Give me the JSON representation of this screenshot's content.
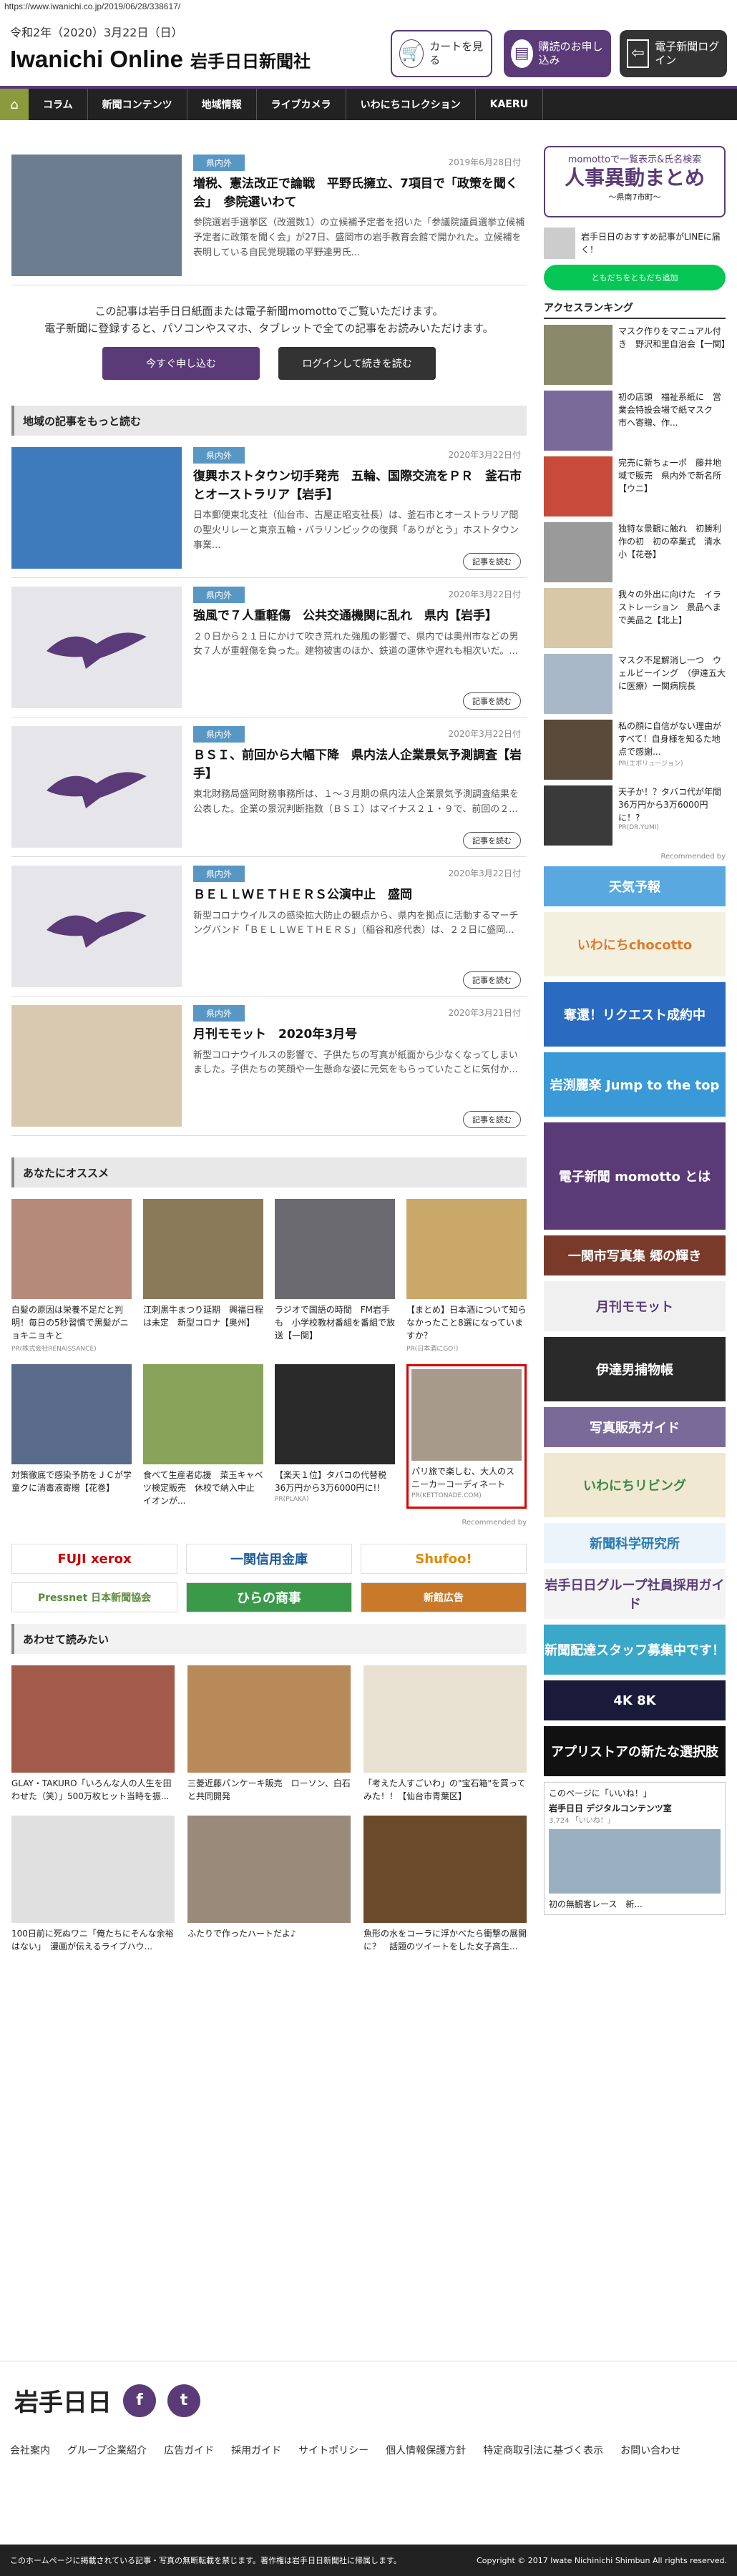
{
  "url": "https://www.iwanichi.co.jp/2019/06/28/338617/",
  "header": {
    "date": "令和2年（2020）3月22日（日）",
    "logo": "Iwanichi Online",
    "logo_sub": "岩手日日新聞社",
    "cart": "カートを見る",
    "subscribe": "購読のお申し込み",
    "login": "電子新聞ログイン"
  },
  "nav": [
    "コラム",
    "新聞コンテンツ",
    "地域情報",
    "ライブカメラ",
    "いわにちコレクション",
    "KAERU"
  ],
  "top_article": {
    "tag": "県内外",
    "date": "2019年6月28日付",
    "title": "増税、憲法改正で論戦　平野氏擁立、7項目で「政策を聞く会」　参院選いわて",
    "text": "参院選岩手選挙区（改選数1）の立候補予定者を招いた「参議院議員選挙立候補予定者に政策を聞く会」が27日、盛岡市の岩手教育会館で開かれた。立候補を表明している自民党現職の平野達男氏..."
  },
  "notice": {
    "line1": "この記事は岩手日日紙面または電子新聞momottoでご覧いただけます。",
    "line2": "電子新聞に登録すると、パソコンやスマホ、タブレットで全ての記事をお読みいただけます。",
    "btn_apply": "今すぐ申し込む",
    "btn_login": "ログインして続きを読む"
  },
  "local_heading": "地域の記事をもっと読む",
  "articles": [
    {
      "tag": "県内外",
      "date": "2020年3月22日付",
      "title": "復興ホストタウン切手発売　五輪、国際交流をＰＲ　釜石市とオーストラリア【岩手】",
      "text": "日本郵便東北支社（仙台市、古屋正昭支社長）は、釜石市とオーストラリア間の聖火リレーと東京五輪・パラリンピックの復興「ありがとう」ホストタウン事業...",
      "more": "記事を読む"
    },
    {
      "tag": "県内外",
      "date": "2020年3月22日付",
      "title": "強風で７人重軽傷　公共交通機関に乱れ　県内【岩手】",
      "text": "２０日から２１日にかけて吹き荒れた強風の影響で、県内では奥州市などの男女７人が重軽傷を負った。建物被害のほか、鉄道の運休や遅れも相次いだ。...",
      "more": "記事を読む"
    },
    {
      "tag": "県内外",
      "date": "2020年3月22日付",
      "title": "ＢＳＩ、前回から大幅下降　県内法人企業景気予測調査【岩手】",
      "text": "東北財務局盛岡財務事務所は、１～３月期の県内法人企業景気予測調査結果を公表した。企業の景況判断指数（ＢＳＩ）はマイナス２１・９で、前回の２...",
      "more": "記事を読む"
    },
    {
      "tag": "県内外",
      "date": "2020年3月22日付",
      "title": "ＢＥＬＬＷＥＴＨＥＲＳ公演中止　盛岡",
      "text": "新型コロナウイルスの感染拡大防止の観点から、県内を拠点に活動するマーチングバンド「ＢＥＬＬＷＥＴＨＥＲＳ」（稲谷和彦代表）は、２２日に盛岡...",
      "more": "記事を読む"
    },
    {
      "tag": "県内外",
      "date": "2020年3月21日付",
      "title": "月刊モモット　2020年3月号",
      "text": "新型コロナウイルスの影響で、子供たちの写真が紙面から少なくなってしまいました。子供たちの笑顔や一生懸命な姿に元気をもらっていたことに気付か...",
      "more": "記事を読む"
    }
  ],
  "recommend_heading": "あなたにオススメ",
  "recommend": [
    {
      "t": "白髪の原因は栄養不足だと判明！毎日の5秒習慣で黒髪がニョキニョキと",
      "s": "PR(株式会社RENAISSANCE)"
    },
    {
      "t": "江刺黒牛まつり延期　興福日程は未定　新型コロナ【奥州】",
      "s": ""
    },
    {
      "t": "ラジオで国語の時間　FM岩手も　小学校教材番組を番組で放送【一関】",
      "s": ""
    },
    {
      "t": "【まとめ】日本酒について知らなかったこと8選になっていますか？",
      "s": "PR(日本酒にGO!)"
    },
    {
      "t": "対策徹底で感染予防をＪＣが学童クに消毒液寄贈【花巻】",
      "s": ""
    },
    {
      "t": "食べて生産者応援　菜玉キャベツ検定販売　休校で納入中止　イオンが...",
      "s": ""
    },
    {
      "t": "【楽天１位】タバコの代替税36万円から3万6000円に!!",
      "s": "PR(PLAKA)"
    },
    {
      "t": "パリ旅で楽しむ、大人のスニーカーコーディネート",
      "s": "PR(KETTONADE.COM)"
    }
  ],
  "recommended_by": "Recommended by",
  "banners": [
    "FUJI xerox",
    "一関信用金庫",
    "Shufoo!",
    "Pressnet 日本新聞協会",
    "ひらの商事",
    "新館広告"
  ],
  "also_heading": "あわせて読みたい",
  "also": [
    {
      "t": "GLAY・TAKURO「いろんな人の人生を田わせた（笑）」500万枚ヒット当時を振..."
    },
    {
      "t": "三菱近藤パンケーキ販売　ローソン、白石と共同開発"
    },
    {
      "t": "「考えた人すごいわ」の\"宝石箱\"を買ってみた！！【仙台市青葉区】"
    },
    {
      "t": "100日前に死ぬワニ「俺たちにそんな余裕はない」　漫画が伝えるライブハウ..."
    },
    {
      "t": "ふたりで作ったハートだよ♪"
    },
    {
      "t": "魚形の水をコーラに浮かべたら衝撃の展開に？　話題のツイートをした女子高生..."
    }
  ],
  "sidebar": {
    "momotto": {
      "a": "momottoで一覧表示&氏名検索",
      "b": "人事異動まとめ",
      "c": "〜県南7市町〜"
    },
    "line": {
      "text": "岩手日日のおすすめ記事がLINEに届く！",
      "btn": "ともだちをともだち追加"
    },
    "ranking_heading": "アクセスランキング",
    "ranking": [
      {
        "t": "マスク作りをマニュアル付き　野沢和里自治会【一関】",
        "s": ""
      },
      {
        "t": "初の店頭　福祉系紙に　営業会特設会場で紙マスク　市へ寄贈、作...",
        "s": ""
      },
      {
        "t": "完売に新ちょ一ポ　藤井地域で販売　県内外で新名所【ウニ】",
        "s": ""
      },
      {
        "t": "独特な景観に触れ　初勝利作の初　初の卒業式　清水小【花巻】",
        "s": ""
      },
      {
        "t": "我々の外出に向けた　イラストレーション　景品へまで美品之【北上】",
        "s": ""
      },
      {
        "t": "マスク不足解消し一つ　ウェルビーイング　（伊達五大に医療）一関病院長",
        "s": ""
      },
      {
        "t": "私の顔に自信がない理由がすべて！自身様を知るた地点で感謝...",
        "s": "PR(エポリュージョン)"
      },
      {
        "t": "天子か！？タバコ代が年間36万円から3万6000円に！?",
        "s": "PR(DR.YUMI)"
      }
    ],
    "recommended_by": "Recommended by",
    "sbanners": [
      "天気予報",
      "いわにちchocotto",
      "奪還！リクエスト成約中",
      "岩渕麗楽 Jump to the top",
      "電子新聞 momotto とは",
      "一関市写真集 郷の輝き",
      "月刊モモット",
      "伊達男捕物帳",
      "写真販売ガイド",
      "いわにちリビング",
      "新聞科学研究所",
      "岩手日日グループ社員採用ガイド",
      "新聞配達スタッフ募集中です！",
      "4K 8K",
      "アプリストアの新たな選択肢"
    ],
    "fb_heading": "このページに「いいね！」",
    "fb": {
      "name": "岩手日日 デジタルコンテンツ室",
      "likes": "3,724 「いいね！」",
      "post": "初の無観客レース　新..."
    }
  },
  "footer": {
    "logo": "岩手日日",
    "links": [
      "会社案内",
      "グループ企業紹介",
      "広告ガイド",
      "採用ガイド",
      "サイトポリシー",
      "個人情報保護方針",
      "特定商取引法に基づく表示",
      "お問い合わせ"
    ],
    "notice": "このホームページに掲載されている記事・写真の無断転載を禁じます。著作権は岩手日日新聞社に帰属します。",
    "copyright": "Copyright © 2017 Iwate Nichinichi Shimbun All rights reserved."
  }
}
